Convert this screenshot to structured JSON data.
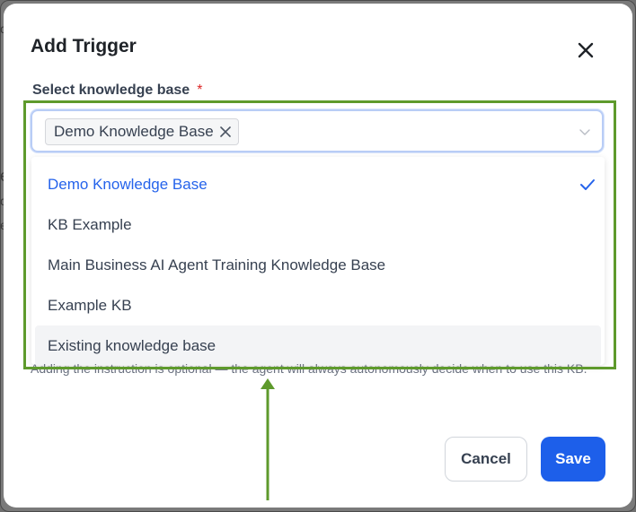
{
  "modal": {
    "title": "Add Trigger",
    "close_icon": "close-icon"
  },
  "field": {
    "label": "Select knowledge base",
    "required_mark": "*",
    "selected_tag": "Demo Knowledge Base",
    "tag_remove_icon": "x-icon",
    "dropdown_icon": "chevron-down-icon"
  },
  "dropdown": {
    "options": [
      {
        "label": "Demo Knowledge Base",
        "selected": true
      },
      {
        "label": "KB Example",
        "selected": false
      },
      {
        "label": "Main Business AI Agent Training Knowledge Base",
        "selected": false
      },
      {
        "label": "Example KB",
        "selected": false
      },
      {
        "label": "Existing knowledge base",
        "selected": false,
        "hovered": true
      }
    ],
    "check_icon": "check-icon"
  },
  "helper": {
    "text": "Adding the instruction is optional — the agent will always autonomously decide when to use this KB."
  },
  "buttons": {
    "cancel": "Cancel",
    "save": "Save"
  },
  "annotation": {
    "highlight_color": "#5e9a2c",
    "arrow_icon": "arrow-up-icon"
  },
  "colors": {
    "accent": "#1d5fea",
    "selected_text": "#2563eb",
    "required": "#dc2626"
  }
}
